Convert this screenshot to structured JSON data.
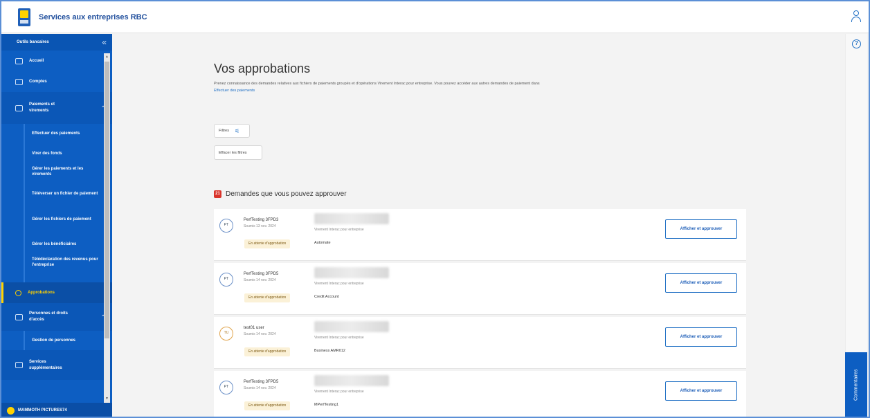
{
  "header": {
    "brand": "Services aux entreprises RBC"
  },
  "sidebar": {
    "heading": "Outils bancaires",
    "collapse_glyph": "«",
    "items": [
      {
        "label": "Accueil"
      },
      {
        "label": "Comptes"
      },
      {
        "label": "Paiements et virements"
      },
      {
        "label": "Effectuer des paiements"
      },
      {
        "label": "Virer des fonds"
      },
      {
        "label": "Gérer les paiements et les virements"
      },
      {
        "label": "Téléverser un fichier de paiement"
      },
      {
        "label": "Gérer les fichiers de paiement"
      },
      {
        "label": "Gérer les bénéficiaires"
      },
      {
        "label": "Télédéclaration des revenus pour l'entreprise"
      },
      {
        "label": "Approbations"
      },
      {
        "label": "Personnes et droits d'accès"
      },
      {
        "label": "Gestion de personnes"
      },
      {
        "label": "Services supplémentaires"
      }
    ],
    "footer": "MAMMOTH PICTURES74",
    "footer_initials": "MP"
  },
  "main": {
    "title": "Vos approbations",
    "intro": "Prenez connaissance des demandes relatives aux fichiers de paiements groupés et d'opérations Virement Interac pour entreprise. Vous pouvez accéder aux autres demandes de paiement dans",
    "intro_link": "Effectuer des paiements",
    "filters_label": "Filtres",
    "clear_filters_label": "Effacer les filtres",
    "section_title": "Demandes que vous pouvez approuver",
    "section_badge": "21",
    "requests": [
      {
        "initials": "PT",
        "name": "PerfTesting 3FPD3",
        "date": "Soumis 13 nov. 2024",
        "status": "En attente d'approbation",
        "type": "Virement Interac pour entreprise",
        "account": "Automate",
        "action": "Afficher et approuver"
      },
      {
        "initials": "PT",
        "name": "PerfTesting 3FPD5",
        "date": "Soumis 14 nov. 2024",
        "status": "En attente d'approbation",
        "type": "Virement Interac pour entreprise",
        "account": "Credit Account",
        "action": "Afficher et approuver"
      },
      {
        "initials": "TU",
        "name": "test01 user",
        "date": "Soumis 14 nov. 2024",
        "status": "En attente d'approbation",
        "type": "Virement Interac pour entreprise",
        "account": "Business AMR012",
        "action": "Afficher et approuver"
      },
      {
        "initials": "PT",
        "name": "PerfTesting 3FPD5",
        "date": "Soumis 14 nov. 2024",
        "status": "En attente d'approbation",
        "type": "Virement Interac pour entreprise",
        "account": "MPerfTesting1",
        "action": "Afficher et approuver"
      }
    ]
  },
  "rail": {
    "help_glyph": "?",
    "feedback_label": "Commentaires"
  }
}
